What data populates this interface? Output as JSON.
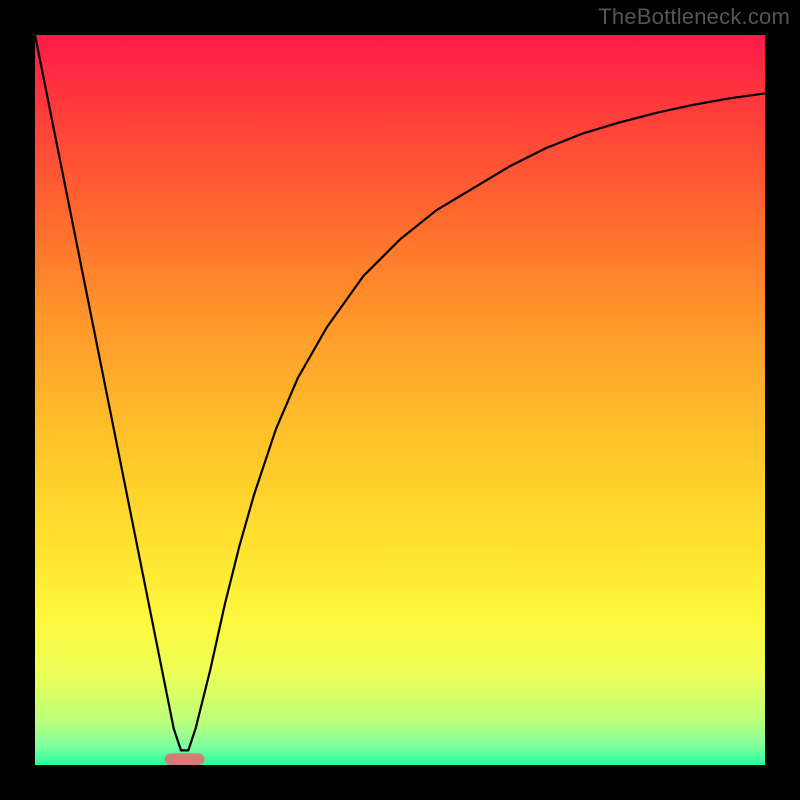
{
  "watermark": "TheBottleneck.com",
  "chart_data": {
    "type": "line",
    "title": "",
    "xlabel": "",
    "ylabel": "",
    "xlim": [
      0,
      100
    ],
    "ylim": [
      0,
      100
    ],
    "grid": false,
    "legend": false,
    "background_gradient": {
      "stops": [
        {
          "offset": 0.0,
          "color": "#ff1a4a"
        },
        {
          "offset": 0.1,
          "color": "#ff3b3b"
        },
        {
          "offset": 0.25,
          "color": "#ff6a2e"
        },
        {
          "offset": 0.4,
          "color": "#ff9a2a"
        },
        {
          "offset": 0.55,
          "color": "#ffc229"
        },
        {
          "offset": 0.7,
          "color": "#ffe22f"
        },
        {
          "offset": 0.8,
          "color": "#fff83f"
        },
        {
          "offset": 0.88,
          "color": "#eaff5a"
        },
        {
          "offset": 0.94,
          "color": "#baff7a"
        },
        {
          "offset": 0.975,
          "color": "#7dffa0"
        },
        {
          "offset": 1.0,
          "color": "#22ff9a"
        }
      ]
    },
    "series": [
      {
        "name": "curve",
        "color": "#000000",
        "stroke_width": 2.2,
        "x": [
          0,
          2,
          4,
          6,
          8,
          10,
          12,
          14,
          16,
          18,
          19,
          20,
          21,
          22,
          24,
          26,
          28,
          30,
          33,
          36,
          40,
          45,
          50,
          55,
          60,
          65,
          70,
          75,
          80,
          85,
          90,
          95,
          100
        ],
        "y": [
          100,
          90,
          80,
          70,
          60,
          50,
          40,
          30,
          20,
          10,
          5,
          2,
          2,
          5,
          13,
          22,
          30,
          37,
          46,
          53,
          60,
          67,
          72,
          76,
          79,
          82,
          84.5,
          86.5,
          88,
          89.3,
          90.4,
          91.3,
          92
        ]
      }
    ],
    "marker": {
      "name": "optimal-region",
      "shape": "rounded-rect",
      "color": "#d87a7a",
      "x_center": 20.5,
      "y": 0,
      "width": 5.5,
      "height": 1.6,
      "corner_radius": 0.9
    }
  }
}
